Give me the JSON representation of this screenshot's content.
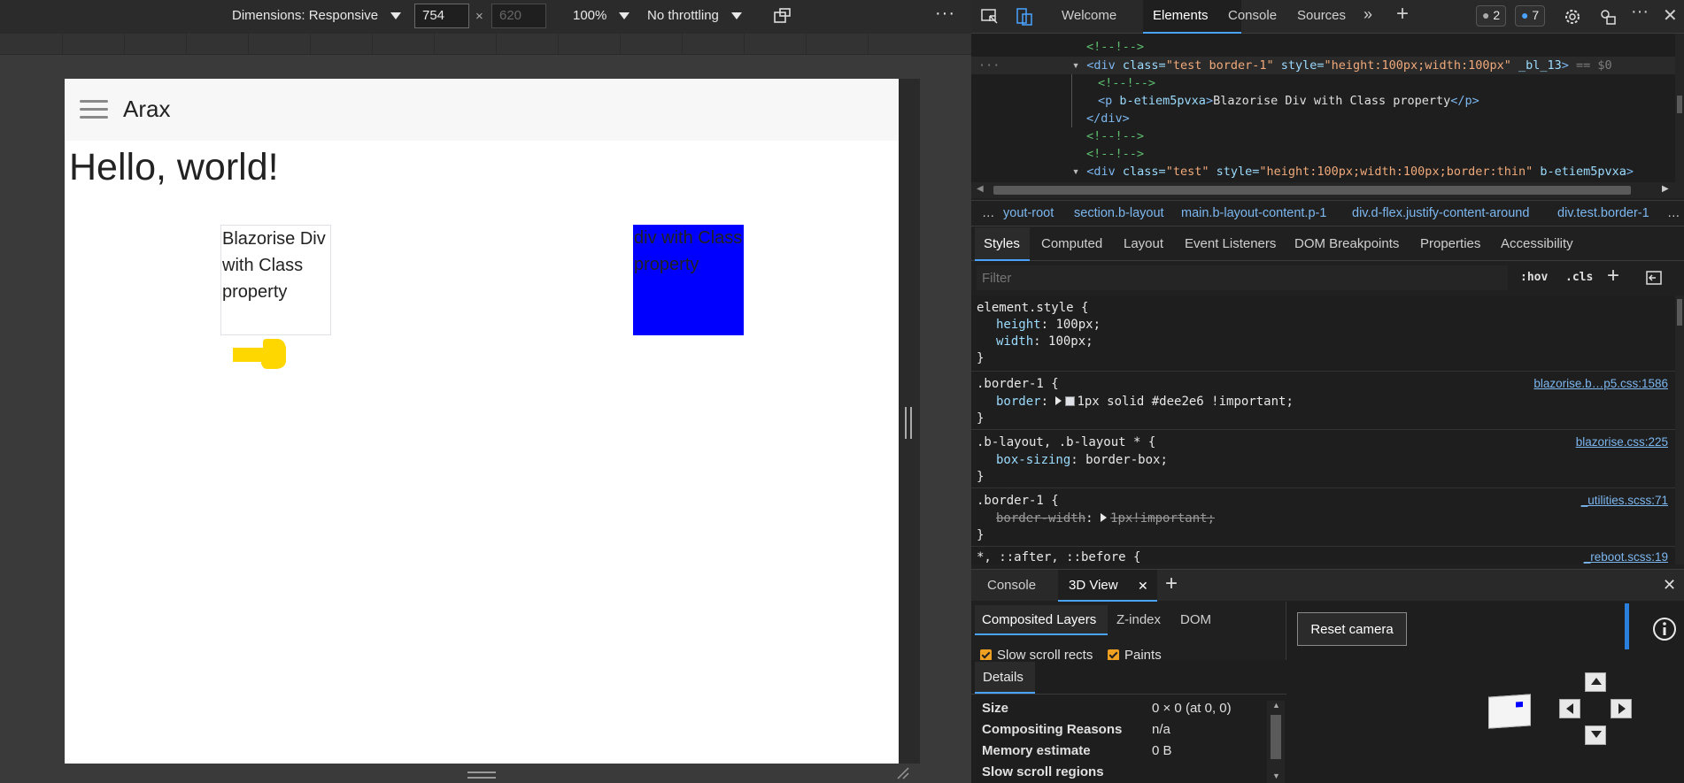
{
  "device_toolbar": {
    "dimensions_label": "Dimensions: Responsive",
    "width_value": "754",
    "times": "×",
    "height_placeholder": "620",
    "zoom": "100%",
    "throttling": "No throttling",
    "more": "⋮"
  },
  "page": {
    "brand": "Arax",
    "heading": "Hello, world!",
    "box1_text": "Blazorise Div with Class property",
    "box2_text": "div with Class property",
    "colors": {
      "box2": "#0000ff",
      "hand": "#ffd700"
    }
  },
  "devtools": {
    "tabs": [
      "Welcome",
      "Elements",
      "Console",
      "Sources"
    ],
    "active_tab": "Elements",
    "badge_issues": "2",
    "badge_messages": "7",
    "dom_lines": [
      {
        "kind": "comment",
        "text": "<!--!-->"
      },
      {
        "kind": "selected",
        "tag_open": "<div ",
        "a1": "class=",
        "v1": "\"test border-1\"",
        "a2": " style=",
        "v2": "\"height:100px;width:100px\"",
        "a3": " _bl_13",
        "close": ">",
        "eq": " == $0"
      },
      {
        "kind": "comment",
        "text": "<!--!-->"
      },
      {
        "kind": "p",
        "open": "<p ",
        "attr": "b-etiem5pvxa",
        "close": ">",
        "text": "Blazorise Div with Class property",
        "end": "</p>"
      },
      {
        "kind": "end",
        "text": "</div>"
      },
      {
        "kind": "comment",
        "text": "<!--!-->"
      },
      {
        "kind": "comment",
        "text": "<!--!-->"
      },
      {
        "kind": "div2",
        "tag_open": "<div ",
        "a1": "class=",
        "v1": "\"test\"",
        "a2": " style=",
        "v2": "\"height:100px;width:100px;border:thin\"",
        "a3": " b-etiem5pvxa",
        "close": ">"
      }
    ],
    "breadcrumbs": [
      "…",
      "yout-root",
      "section.b-layout",
      "main.b-layout-content.p-1",
      "div.d-flex.justify-content-around",
      "div.test.border-1",
      "…"
    ],
    "subtabs": [
      "Styles",
      "Computed",
      "Layout",
      "Event Listeners",
      "DOM Breakpoints",
      "Properties",
      "Accessibility"
    ],
    "filter_placeholder": "Filter",
    "hov": ":hov",
    "cls": ".cls",
    "rules": [
      {
        "selector": "element.style {",
        "props": [
          [
            "height",
            "100px;"
          ],
          [
            "width",
            "100px;"
          ]
        ],
        "source": ""
      },
      {
        "selector": ".border-1 {",
        "props": [
          [
            "border",
            "1px solid #dee2e6 !important;"
          ]
        ],
        "source": "blazorise.b…p5.css:1586"
      },
      {
        "selector": ".b-layout, .b-layout * {",
        "props": [
          [
            "box-sizing",
            "border-box;"
          ]
        ],
        "source": "blazorise.css:225"
      },
      {
        "selector": ".border-1 {",
        "props": [
          [
            "border-width",
            "1px!important;"
          ]
        ],
        "source": "_utilities.scss:71"
      },
      {
        "selector": "*, ::after, ::before {",
        "props": [],
        "source": "_reboot.scss:19"
      }
    ],
    "close_brace": "}",
    "drawer_tabs": [
      "Console",
      "3D View"
    ],
    "layer_tabs": [
      "Composited Layers",
      "Z-index",
      "DOM"
    ],
    "checkboxes": [
      "Slow scroll rects",
      "Paints"
    ],
    "details_title": "Details",
    "details": [
      {
        "label": "Size",
        "value": "0 × 0 (at 0, 0)"
      },
      {
        "label": "Compositing Reasons",
        "value": "n/a"
      },
      {
        "label": "Memory estimate",
        "value": "0 B"
      },
      {
        "label": "Slow scroll regions",
        "value": ""
      }
    ],
    "reset_camera": "Reset camera"
  }
}
